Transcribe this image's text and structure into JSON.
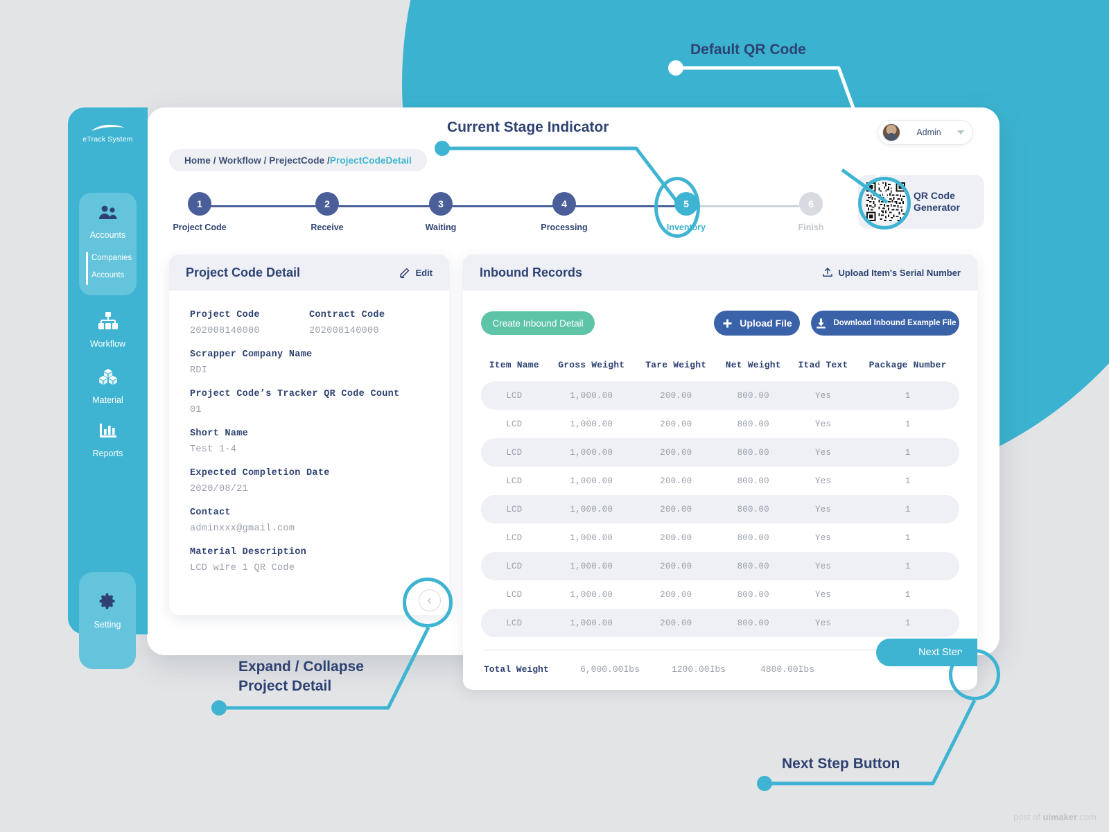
{
  "brand": {
    "name": "eTrack System",
    "teal": "#3fb4d2",
    "navy": "#2e4272",
    "blue": "#4a5f99",
    "green": "#5ec4a7",
    "btn_blue": "#3a62a8"
  },
  "sidebar": {
    "logo": "eTrack System",
    "items": [
      {
        "label": "Accounts",
        "icon": "users-icon",
        "active": true
      },
      {
        "label": "Workflow",
        "icon": "sitemap-icon",
        "active": false
      },
      {
        "label": "Material",
        "icon": "boxes-icon",
        "active": false
      },
      {
        "label": "Reports",
        "icon": "bar-chart-icon",
        "active": false
      }
    ],
    "submenu": [
      "Companies",
      "Accounts"
    ],
    "setting": {
      "label": "Setting",
      "icon": "gear-icon"
    }
  },
  "header": {
    "breadcrumb": {
      "trail": "Home / Workflow / PrejectCode / ",
      "current": "ProjectCodeDetail"
    },
    "user": {
      "name": "Admin",
      "avatar": "avatar",
      "caret": "chevron-down-icon"
    },
    "qr_widget": {
      "title_line1": "QR Code",
      "title_line2": "Generator",
      "icon": "qr-code-icon"
    }
  },
  "stepper": {
    "steps": [
      {
        "num": "1",
        "label": "Project Code",
        "state": "done"
      },
      {
        "num": "2",
        "label": "Receive",
        "state": "done"
      },
      {
        "num": "3",
        "label": "Waiting",
        "state": "done"
      },
      {
        "num": "4",
        "label": "Processing",
        "state": "done"
      },
      {
        "num": "5",
        "label": "Inventory",
        "state": "active"
      },
      {
        "num": "6",
        "label": "Finish",
        "state": "off"
      }
    ]
  },
  "detail_panel": {
    "title": "Project Code Detail",
    "edit_label": "Edit",
    "edit_icon": "pencil-icon",
    "fields": [
      {
        "key": "Project Code",
        "value": "202008140000"
      },
      {
        "key": "Contract Code",
        "value": "202008140000"
      },
      {
        "key": "Scrapper Company Name",
        "value": "RDI"
      },
      {
        "key": "Project Code’s Tracker QR Code Count",
        "value": "01"
      },
      {
        "key": "Short Name",
        "value": "Test 1-4"
      },
      {
        "key": "Expected Completion Date",
        "value": "2020/08/21"
      },
      {
        "key": "Contact",
        "value": "adminxxx@gmail.com"
      },
      {
        "key": "Material Description",
        "value": "LCD wire 1 QR Code"
      }
    ]
  },
  "records_panel": {
    "title": "Inbound Records",
    "upload_serial_label": "Upload Item's Serial Number",
    "upload_serial_icon": "upload-icon",
    "buttons": {
      "create": "Create Inbound Detail",
      "upload": "Upload File",
      "upload_icon": "plus-icon",
      "download": "Download Inbound Example File",
      "download_icon": "download-icon",
      "next_step": "Next Step"
    },
    "columns": [
      "Item Name",
      "Gross Weight",
      "Tare Weight",
      "Net Weight",
      "Itad Text",
      "Package Number"
    ],
    "rows": [
      [
        "LCD",
        "1,000.00",
        "200.00",
        "800.00",
        "Yes",
        "1"
      ],
      [
        "LCD",
        "1,000.00",
        "200.00",
        "800.00",
        "Yes",
        "1"
      ],
      [
        "LCD",
        "1,000.00",
        "200.00",
        "800.00",
        "Yes",
        "1"
      ],
      [
        "LCD",
        "1,000.00",
        "200.00",
        "800.00",
        "Yes",
        "1"
      ],
      [
        "LCD",
        "1,000.00",
        "200.00",
        "800.00",
        "Yes",
        "1"
      ],
      [
        "LCD",
        "1,000.00",
        "200.00",
        "800.00",
        "Yes",
        "1"
      ],
      [
        "LCD",
        "1,000.00",
        "200.00",
        "800.00",
        "Yes",
        "1"
      ],
      [
        "LCD",
        "1,000.00",
        "200.00",
        "800.00",
        "Yes",
        "1"
      ],
      [
        "LCD",
        "1,000.00",
        "200.00",
        "800.00",
        "Yes",
        "1"
      ]
    ],
    "totals": {
      "label": "Total Weight",
      "gross": "6,000.00Ibs",
      "tare": "1200.00Ibs",
      "net": "4800.00Ibs"
    }
  },
  "annotations": {
    "default_qr": "Default QR Code",
    "stage_indicator": "Current Stage Indicator",
    "expand_collapse_l1": "Expand / Collapse",
    "expand_collapse_l2": "Project Detail",
    "next_step": "Next Step Button"
  },
  "watermark": {
    "prefix": "post of ",
    "brand": "uimaker",
    "suffix": ".com"
  }
}
